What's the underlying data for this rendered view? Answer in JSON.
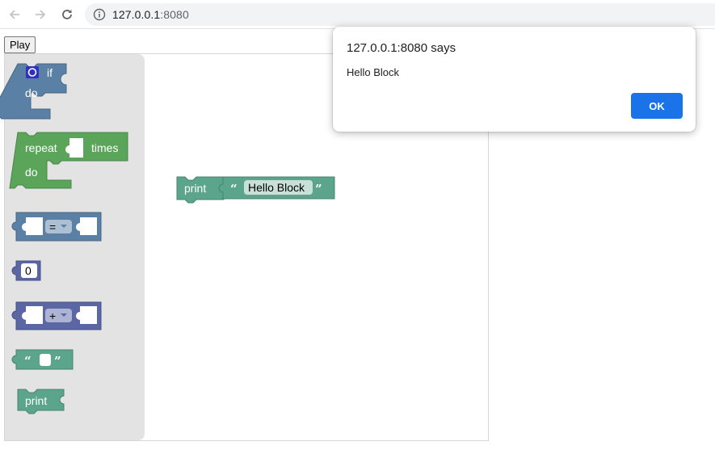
{
  "browser": {
    "url_host": "127.0.0.1",
    "url_port": ":8080",
    "back_icon": "arrow-left-icon",
    "forward_icon": "arrow-right-icon",
    "reload_icon": "reload-icon",
    "info_icon": "info-icon"
  },
  "page": {
    "play_label": "Play"
  },
  "toolbox": {
    "if_label": "if",
    "if_do_label": "do",
    "repeat_label": "repeat",
    "times_label": "times",
    "repeat_do_label": "do",
    "compare_op": "=",
    "number_value": "0",
    "arith_op": "+",
    "print_label": "print",
    "open_quote": "“",
    "close_quote": "”"
  },
  "canvas": {
    "print_label": "print",
    "text_value": "Hello Block",
    "open_quote": "“",
    "close_quote": "”"
  },
  "alert": {
    "title": "127.0.0.1:8080 says",
    "message": "Hello Block",
    "ok_label": "OK"
  },
  "colors": {
    "logic": "#5b80a5",
    "loop": "#5ba55b",
    "math": "#5b67a5",
    "text": "#5ba58c",
    "accent": "#1a73e8"
  }
}
